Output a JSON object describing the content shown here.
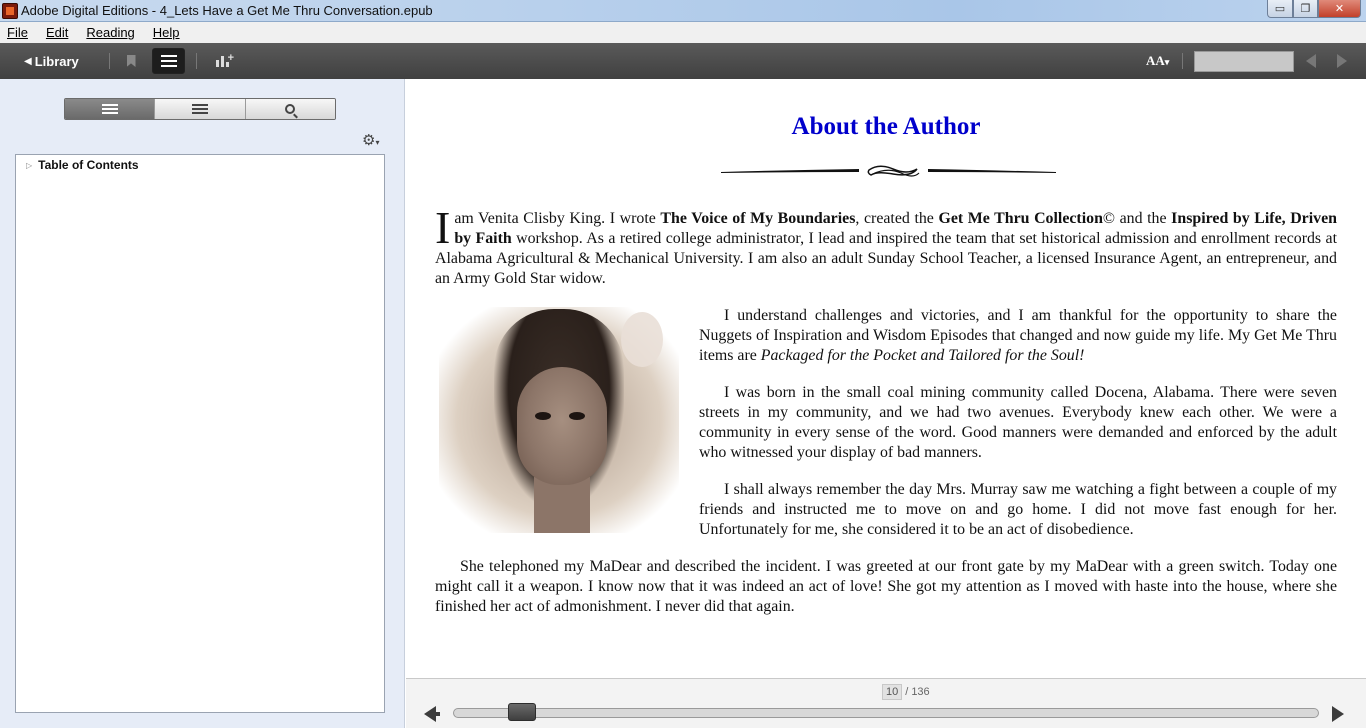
{
  "window": {
    "title": "Adobe Digital Editions - 4_Lets Have a Get Me Thru Conversation.epub",
    "min_glyph": "▭",
    "max_glyph": "❐",
    "close_glyph": "✕"
  },
  "menu": {
    "items": [
      {
        "label": "File"
      },
      {
        "label": "Edit"
      },
      {
        "label": "Reading"
      },
      {
        "label": "Help"
      }
    ]
  },
  "toolbar": {
    "library_label": "Library",
    "library_arrow": "◀",
    "font_size_label": "AA",
    "font_size_caret": "▾"
  },
  "sidebar": {
    "gear_glyph": "⚙",
    "toc_root_label": "Table of Contents",
    "toc_root_arrow": "▷"
  },
  "book": {
    "heading": "About the Author",
    "p1": {
      "dropcap": "I",
      "t1": " am Venita Clisby King. I wrote ",
      "b1": "The Voice of My Boundaries",
      "t2": ", created the ",
      "b2": "Get Me Thru Collection",
      "t3": "© and the ",
      "b3": "Inspired by Life, Driven by Faith",
      "t4": " workshop. As a retired college administrator, I lead and inspired the team that set historical admission and enrollment records at Alabama Agricultural & Mechanical University. I am also an adult Sunday School Teacher, a licensed Insurance Agent, an entrepreneur, and an Army Gold Star widow."
    },
    "p2": {
      "t1": "I understand challenges and victories, and I am thankful for the opportunity to share the Nuggets of Inspiration and Wisdom Episodes that changed and now guide my life. My Get Me Thru items are ",
      "i1": "Packaged for the Pocket and Tailored for the Soul!"
    },
    "p3": "I was born in the small coal mining community called Docena, Alabama. There were seven streets in my community, and we had two avenues. Everybody knew each other. We were a community in every sense of the word. Good manners were demanded and enforced by the adult who witnessed your display of bad manners.",
    "p4": "I shall always remember the day Mrs. Murray saw me watching a fight between a couple of my friends and instructed me to move on and go home. I did not move fast enough for her. Unfortunately for me, she considered it to be an act of disobedience.",
    "p5": "She telephoned my MaDear and described the incident. I was greeted at our front gate by my MaDear with a green switch. Today one might call it a weapon. I know now that it was indeed an act of love! She got my attention as I moved with haste into the house, where she finished her act of admonishment. I never did that again."
  },
  "pager": {
    "current_page": "10",
    "separator": "/",
    "total_pages": "136",
    "progress_fraction": 0.066
  },
  "colors": {
    "heading": "#0000cc",
    "toolbar": "#4a4a4a",
    "sidebar_bg": "#e6ecf7"
  }
}
